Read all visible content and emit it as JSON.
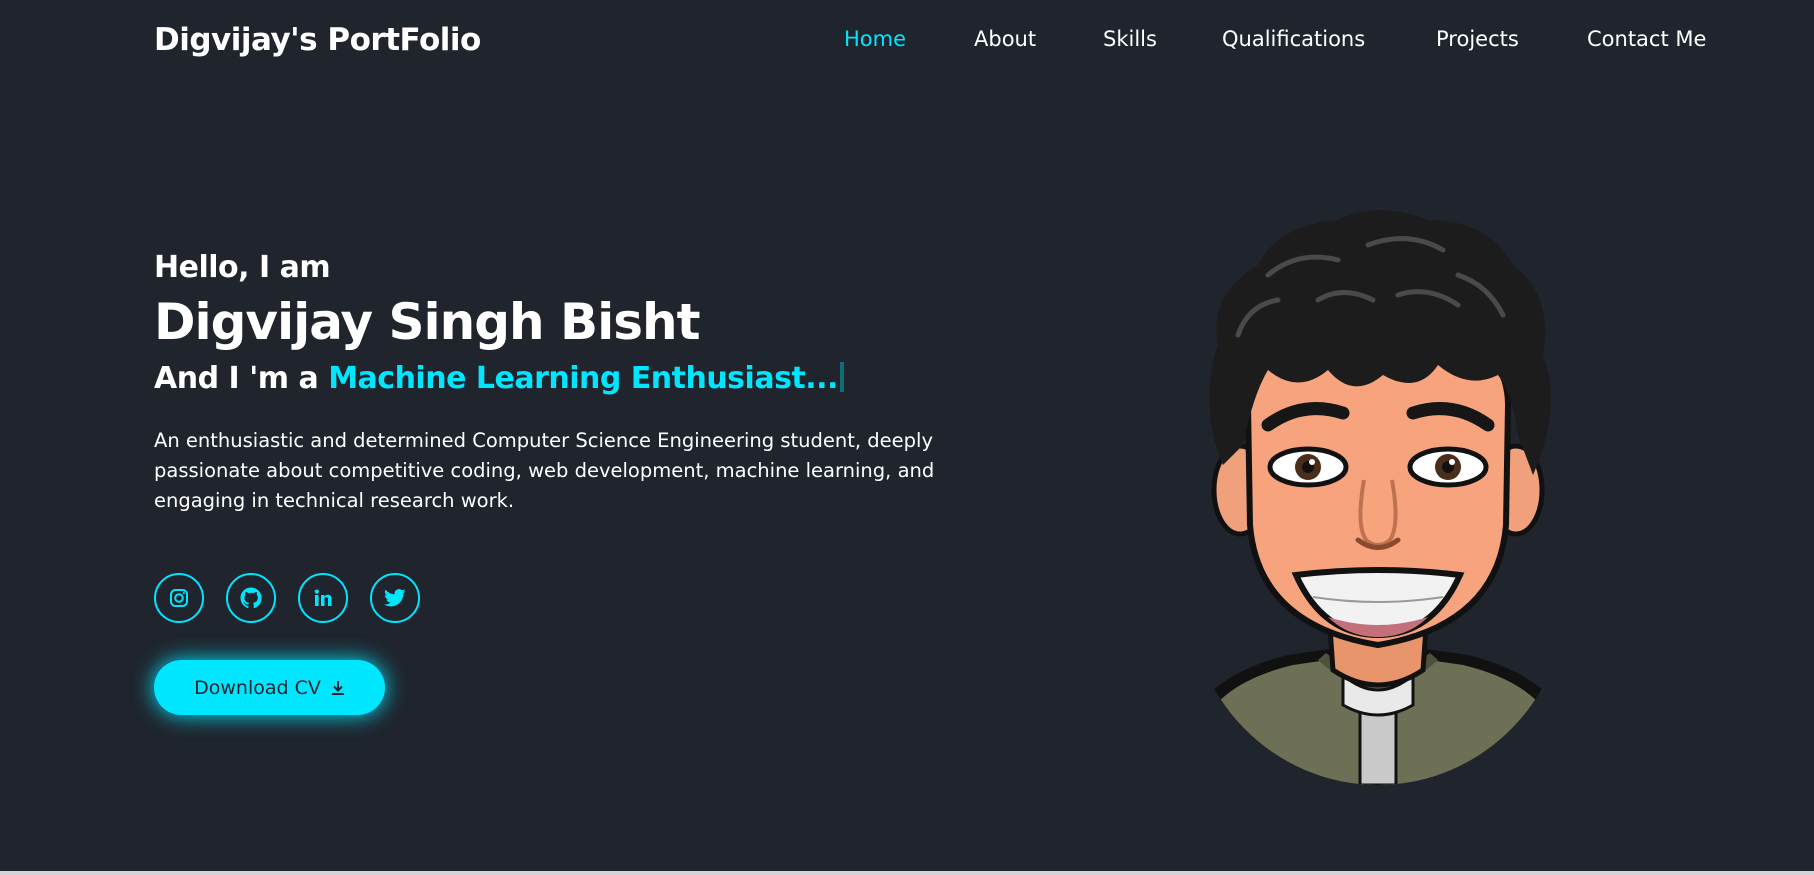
{
  "header": {
    "logo": "Digvijay's PortFolio",
    "nav": [
      {
        "label": "Home",
        "active": true
      },
      {
        "label": "About",
        "active": false
      },
      {
        "label": "Skills",
        "active": false
      },
      {
        "label": "Qualifications",
        "active": false
      },
      {
        "label": "Projects",
        "active": false
      },
      {
        "label": "Contact Me",
        "active": false
      }
    ]
  },
  "hero": {
    "greeting": "Hello, I am",
    "name": "Digvijay Singh Bisht",
    "role_prefix": "And I 'm a ",
    "role_typed": "Machine Learning Enthusiast...",
    "bio": "An enthusiastic and determined Computer Science Engineering student, deeply passionate about competitive coding, web development, machine learning, and engaging in technical research work."
  },
  "socials": [
    {
      "icon": "instagram-icon"
    },
    {
      "icon": "github-icon"
    },
    {
      "icon": "linkedin-icon"
    },
    {
      "icon": "twitter-icon"
    }
  ],
  "cv_button": {
    "label": "Download CV",
    "icon": "download-icon"
  },
  "avatar": {
    "icon": "avatar-illustration"
  },
  "colors": {
    "background": "#1f242d",
    "accent": "#00e6ff",
    "text": "#ffffff"
  }
}
